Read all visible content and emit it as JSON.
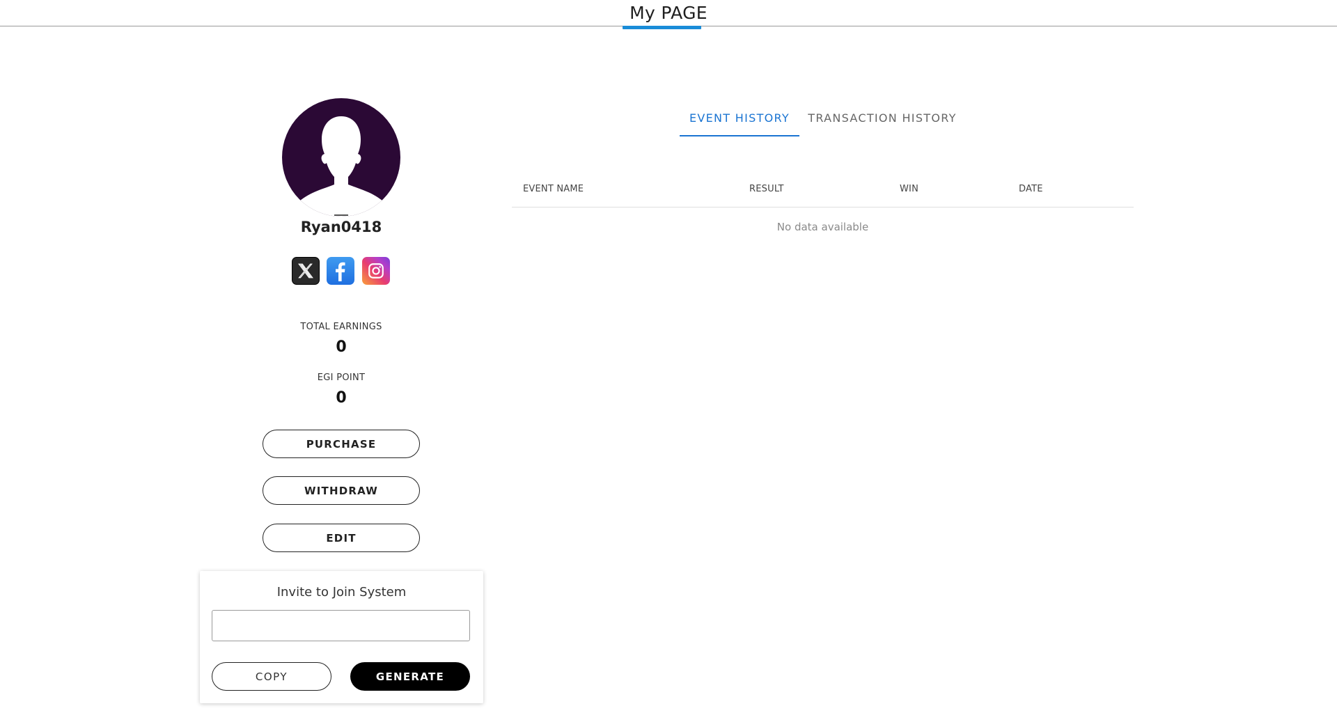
{
  "header": {
    "title": "My PAGE",
    "accent_color": "#1a8cd8"
  },
  "profile": {
    "username": "Ryan0418",
    "avatar_color": "#2b0935",
    "social": [
      {
        "name": "x-icon",
        "glyph": "𝕏"
      },
      {
        "name": "facebook-icon",
        "glyph": "f"
      },
      {
        "name": "instagram-icon",
        "glyph": "camera"
      }
    ],
    "total_earnings_label": "TOTAL EARNINGS",
    "total_earnings_value": "0",
    "egi_point_label": "EGI POINT",
    "egi_point_value": "0",
    "buttons": {
      "purchase": "PURCHASE",
      "withdraw": "WITHDRAW",
      "edit": "EDIT"
    }
  },
  "invite": {
    "title": "Invite to Join System",
    "input_value": "",
    "copy_label": "COPY",
    "generate_label": "GENERATE"
  },
  "tabs": [
    {
      "label": "EVENT HISTORY",
      "active": true
    },
    {
      "label": "TRANSACTION HISTORY",
      "active": false
    }
  ],
  "table": {
    "columns": [
      "EVENT NAME",
      "RESULT",
      "WIN",
      "DATE"
    ],
    "rows": [],
    "empty_text": "No data available"
  }
}
